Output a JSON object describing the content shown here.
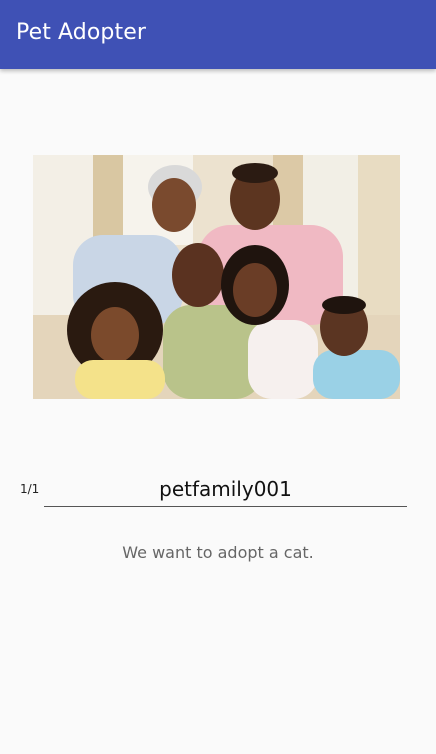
{
  "app_bar": {
    "title": "Pet Adopter"
  },
  "profile": {
    "counter": "1/1",
    "username": "petfamily001",
    "description": "We want to adopt a cat.",
    "photo_icon": "family-photo-image"
  }
}
